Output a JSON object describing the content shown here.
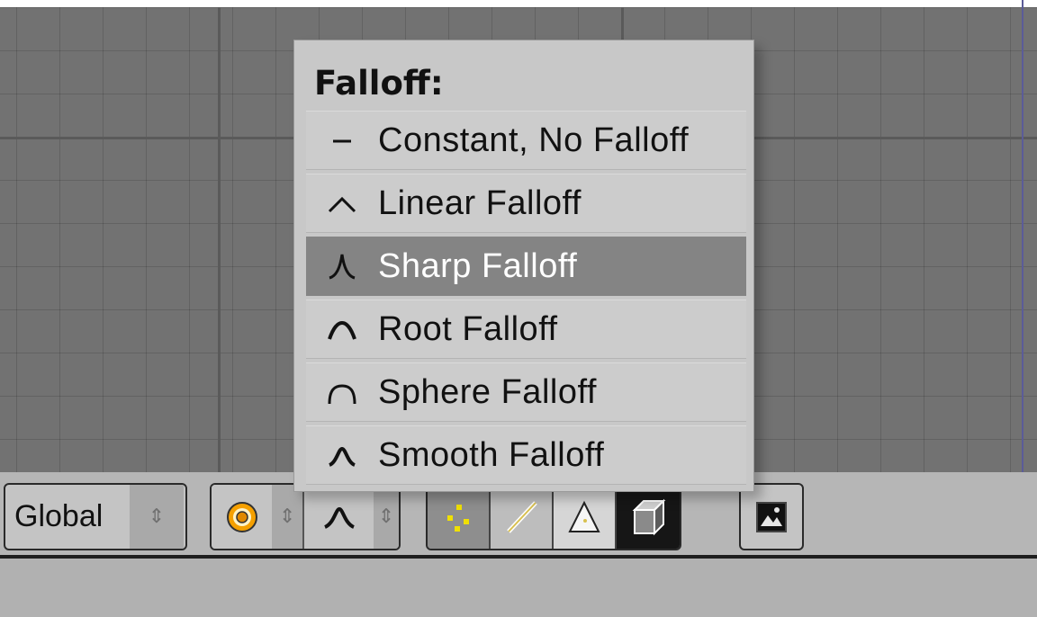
{
  "falloff_menu": {
    "title": "Falloff:",
    "items": [
      {
        "label": "Constant, No Falloff",
        "icon": "constant-falloff-icon",
        "selected": false
      },
      {
        "label": "Linear Falloff",
        "icon": "linear-falloff-icon",
        "selected": false
      },
      {
        "label": "Sharp Falloff",
        "icon": "sharp-falloff-icon",
        "selected": true
      },
      {
        "label": "Root Falloff",
        "icon": "root-falloff-icon",
        "selected": false
      },
      {
        "label": "Sphere Falloff",
        "icon": "sphere-falloff-icon",
        "selected": false
      },
      {
        "label": "Smooth Falloff",
        "icon": "smooth-falloff-icon",
        "selected": false
      }
    ]
  },
  "header": {
    "orientation": {
      "value": "Global"
    },
    "proportional_edit": {
      "icon": "proportional-edit-icon",
      "accent": "#f5a000"
    },
    "falloff_select": {
      "icon": "smooth-falloff-icon"
    },
    "select_modes": [
      {
        "name": "vertex",
        "icon": "vertex-select-icon",
        "accent": "#f0e000"
      },
      {
        "name": "edge",
        "icon": "edge-select-icon"
      },
      {
        "name": "face",
        "icon": "face-select-icon"
      }
    ],
    "occlude": {
      "icon": "cube-icon"
    },
    "render": {
      "icon": "render-image-icon"
    }
  },
  "colors": {
    "viewport_bg": "#727272",
    "menu_bg": "#c8c8c8",
    "menu_highlight": "#848484",
    "header_bg": "#b6b6b6"
  }
}
